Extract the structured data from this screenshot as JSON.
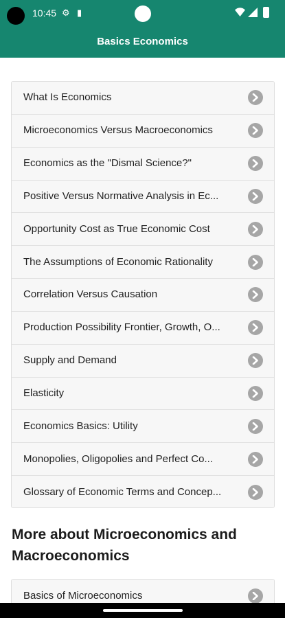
{
  "status_bar": {
    "time": "10:45"
  },
  "app_bar": {
    "title": "Basics Economics"
  },
  "topics": [
    {
      "label": "What Is Economics"
    },
    {
      "label": "Microeconomics Versus Macroeconomics"
    },
    {
      "label": "Economics as the \"Dismal Science?\""
    },
    {
      "label": "Positive Versus Normative Analysis in Ec..."
    },
    {
      "label": "Opportunity Cost as True Economic Cost"
    },
    {
      "label": "The Assumptions of Economic Rationality"
    },
    {
      "label": "Correlation Versus Causation"
    },
    {
      "label": "Production Possibility Frontier, Growth, O..."
    },
    {
      "label": "Supply and Demand"
    },
    {
      "label": "Elasticity"
    },
    {
      "label": "Economics Basics: Utility"
    },
    {
      "label": "Monopolies, Oligopolies and Perfect Co..."
    },
    {
      "label": "Glossary of Economic Terms and Concep..."
    }
  ],
  "more_section": {
    "title": "More about Microeconomics and Macroeconomics",
    "items": [
      {
        "label": "Basics of Microeconomics"
      }
    ]
  },
  "icons": {
    "row_chevron": "chevron-right-circle-icon",
    "status_settings": "gear-icon",
    "status_sim": "sim-card-icon",
    "status_wifi": "wifi-icon",
    "status_signal": "signal-icon",
    "status_battery": "battery-icon"
  },
  "colors": {
    "primary": "#16866f",
    "row_background": "#f7f7f7",
    "chevron": "#a6a6a6"
  }
}
